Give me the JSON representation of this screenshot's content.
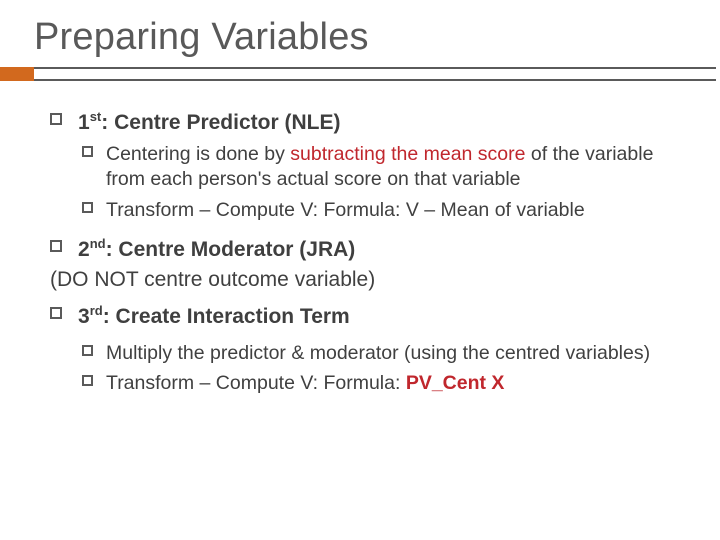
{
  "title": "Preparing Variables",
  "items": {
    "first": {
      "ord": "1",
      "sup": "st",
      "label": ": Centre Predictor (NLE)",
      "sub1_pre": "Centering is done by ",
      "sub1_red": "subtracting the mean score",
      "sub1_post": " of the variable from each person's actual score on that variable",
      "sub2": "Transform – Compute V: Formula: V – Mean of variable"
    },
    "second": {
      "ord": "2",
      "sup": "nd",
      "label": ": Centre Moderator (JRA)"
    },
    "paren": "(DO NOT centre outcome variable)",
    "third": {
      "ord": "3",
      "sup": "rd",
      "label": ": Create Interaction Term",
      "sub1": "Multiply the predictor & moderator (using the centred variables)",
      "sub2_pre": "Transform – Compute V: Formula: ",
      "sub2_red": "PV_Cent X"
    }
  }
}
